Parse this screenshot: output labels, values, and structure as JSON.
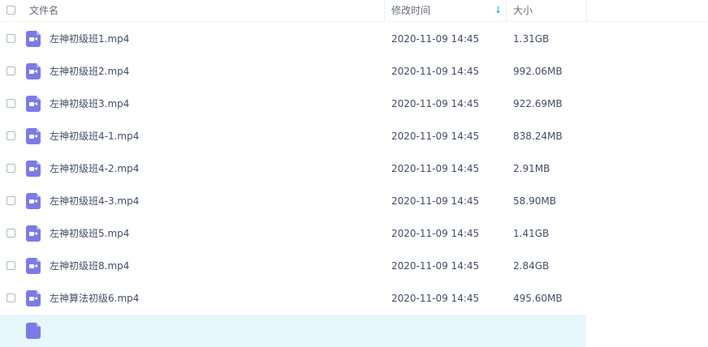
{
  "header": {
    "name_label": "文件名",
    "date_label": "修改时间",
    "size_label": "大小",
    "sort_icon": "arrow-down-icon"
  },
  "files": [
    {
      "name": "左神初级班1.mp4",
      "date": "2020-11-09 14:45",
      "size": "1.31GB"
    },
    {
      "name": "左神初级班2.mp4",
      "date": "2020-11-09 14:45",
      "size": "992.06MB"
    },
    {
      "name": "左神初级班3.mp4",
      "date": "2020-11-09 14:45",
      "size": "922.69MB"
    },
    {
      "name": "左神初级班4-1.mp4",
      "date": "2020-11-09 14:45",
      "size": "838.24MB"
    },
    {
      "name": "左神初级班4-2.mp4",
      "date": "2020-11-09 14:45",
      "size": "2.91MB"
    },
    {
      "name": "左神初级班4-3.mp4",
      "date": "2020-11-09 14:45",
      "size": "58.90MB"
    },
    {
      "name": "左神初级班5.mp4",
      "date": "2020-11-09 14:45",
      "size": "1.41GB"
    },
    {
      "name": "左神初级班8.mp4",
      "date": "2020-11-09 14:45",
      "size": "2.84GB"
    },
    {
      "name": "左神算法初级6.mp4",
      "date": "2020-11-09 14:45",
      "size": "495.60MB"
    }
  ],
  "colors": {
    "accent": "#06a7ff",
    "video_icon": "#7b7be8",
    "selected_row": "#e8f6fd"
  }
}
